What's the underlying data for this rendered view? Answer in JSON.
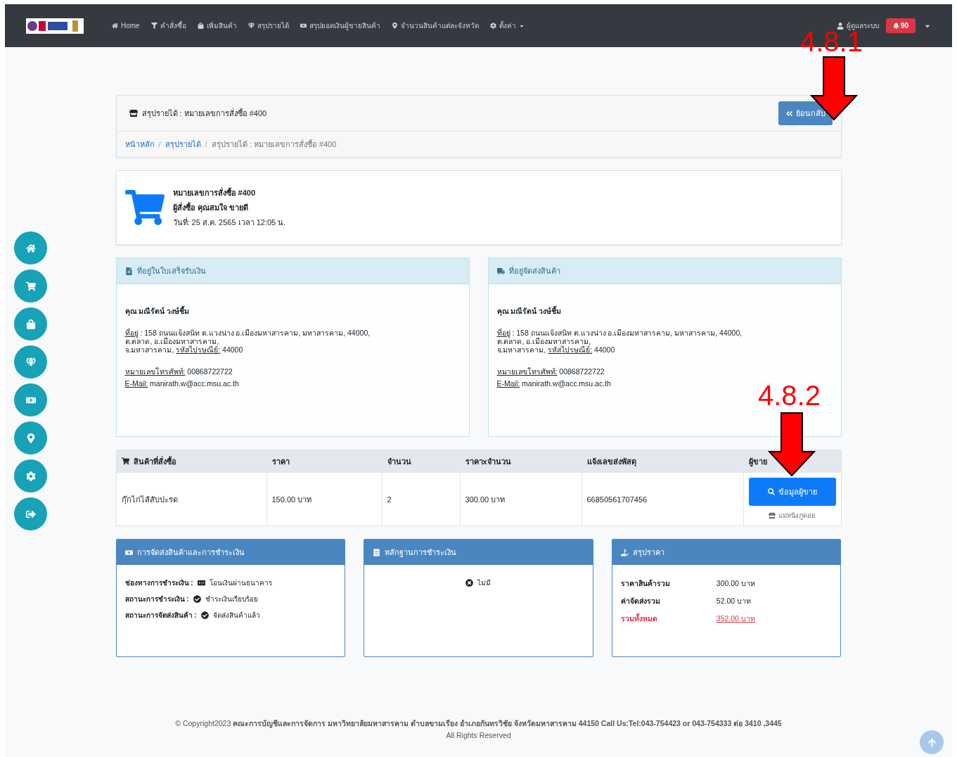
{
  "navbar": {
    "menu": [
      {
        "label": "Home",
        "dropdown": false
      },
      {
        "label": "คำสั่งซื้อ",
        "dropdown": false
      },
      {
        "label": "เพิ่มสินค้า",
        "dropdown": false
      },
      {
        "label": "สรุปรายได้",
        "dropdown": false
      },
      {
        "label": "สรุปยอดเงินผู้ขายสินค้า",
        "dropdown": false
      },
      {
        "label": "จำนวนสินค้าแต่ละจังหวัด",
        "dropdown": false
      },
      {
        "label": "ตั้งค่า",
        "dropdown": true
      }
    ],
    "user": "ผู้ดูแลระบบ",
    "notifications": "90"
  },
  "header": {
    "title": "สรุปรายได้ : หมายเลขการสั่งซื้อ #400",
    "back_button": "ย้อนกลับ"
  },
  "breadcrumb": [
    {
      "label": "หน้าหลัก",
      "link": true
    },
    {
      "separator": "/",
      "label": "สรุปรายได้",
      "link": true
    },
    {
      "separator": "/",
      "label": "สรุปรายได้ : หมายเลขการสั่งซื้อ #400",
      "link": false
    }
  ],
  "order": {
    "number": "หมายเลขการสั่งซื้อ #400",
    "buyer": "ผู้สั่งซื้อ คุณสมใจ ขายดี",
    "date": "วันที่: 25 ส.ค. 2565 เวลา 12:05 น."
  },
  "addresses": [
    {
      "title": "ที่อยู่ในใบเสร็จรับเงิน",
      "name": "คุณ มณีรัตน์ วงษ์ชื้ม",
      "address_label": "ที่อยู่",
      "address": " : 158 ถนนแจ้งสนิท ต.แวงน่าง อ.เมืองมหาสารคาม, มหาสารคาม, 44000,",
      "line2": "ต.ตลาด, อ.เมืองมหาสารคาม,",
      "line3": "จ.มหาสารคาม, ",
      "postal_label": "รหัสไปรษณีย์:",
      "postal": " 44000",
      "phone_label": "หมายเลขโทรศัพท์:",
      "phone": " 00868722722",
      "email_label": "E-Mail:",
      "email": " manirath.w@acc.msu.ac.th"
    },
    {
      "title": "ที่อยู่จัดส่งสินค้า",
      "name": "คุณ มณีรัตน์ วงษ์ชื้ม",
      "address_label": "ที่อยู่",
      "address": " : 158 ถนนแจ้งสนิท ต.แวงน่าง อ.เมืองมหาสารคาม, มหาสารคาม, 44000,",
      "line2": "ต.ตลาด, อ.เมืองมหาสารคาม,",
      "line3": "จ.มหาสารคาม, ",
      "postal_label": "รหัสไปรษณีย์:",
      "postal": " 44000",
      "phone_label": "หมายเลขโทรศัพท์:",
      "phone": " 00868722722",
      "email_label": "E-Mail:",
      "email": " manirath.w@acc.msu.ac.th"
    }
  ],
  "items_table": {
    "columns": [
      "สินค้าที่สั่งซื้อ",
      "ราคา",
      "จำนวน",
      "ราคาxจำนวน",
      "แจ้งเลขส่งพัสดุ",
      "ผู้ขาย"
    ],
    "rows": [
      {
        "product": "กุ๊กไก่ไส้สับปะรด",
        "price": "150.00 บาท",
        "qty": "2",
        "total": "300.00 บาท",
        "tracking": "66850561707456",
        "seller_button": "ข้อมูลผู้ขาย",
        "shop": "แม่หนิงภูดอย"
      }
    ]
  },
  "cards": [
    {
      "kind": "status",
      "title": "การจัดส่งสินค้าและการชำระเงิน",
      "rows": [
        {
          "label": "ช่องทางการชำระเงิน :",
          "value": "โอนเงินผ่านธนาคาร"
        },
        {
          "label": "สถานะการชำระเงิน :",
          "value": "ชำระเงินเรียบร้อย"
        },
        {
          "label": "สถานะการจัดส่งสินค้า :",
          "value": "จัดส่งสินค้าแล้ว"
        }
      ]
    },
    {
      "kind": "evidence",
      "title": "หลักฐานการชำระเงิน",
      "text": "ไม่มี"
    },
    {
      "kind": "summary",
      "title": "สรุปราคา",
      "rows": [
        {
          "label": "ราคาสินค้ารวม",
          "value": "300.00 บาท",
          "total": false
        },
        {
          "label": "ค่าจัดส่งรวม",
          "value": "52.00 บาท",
          "total": false
        },
        {
          "label": "รวมทั้งหมด",
          "value": "352.00 บาท",
          "total": true
        }
      ]
    }
  ],
  "footer": {
    "copyright": "© Copyright2023 ",
    "org": "คณะการบัญชีและการจัดการ มหาวิทยาลัยมหาสารคาม ตำบลขามเรียง อำเภอกันทรวิชัย จังหวัดมหาสารคาม 44150 Call Us:Tel:043-754423 or 043-754333 ต่อ 3410 ,3445",
    "rights": "All Rights Reserved"
  },
  "annotations": [
    "4.8.1",
    "4.8.2"
  ]
}
